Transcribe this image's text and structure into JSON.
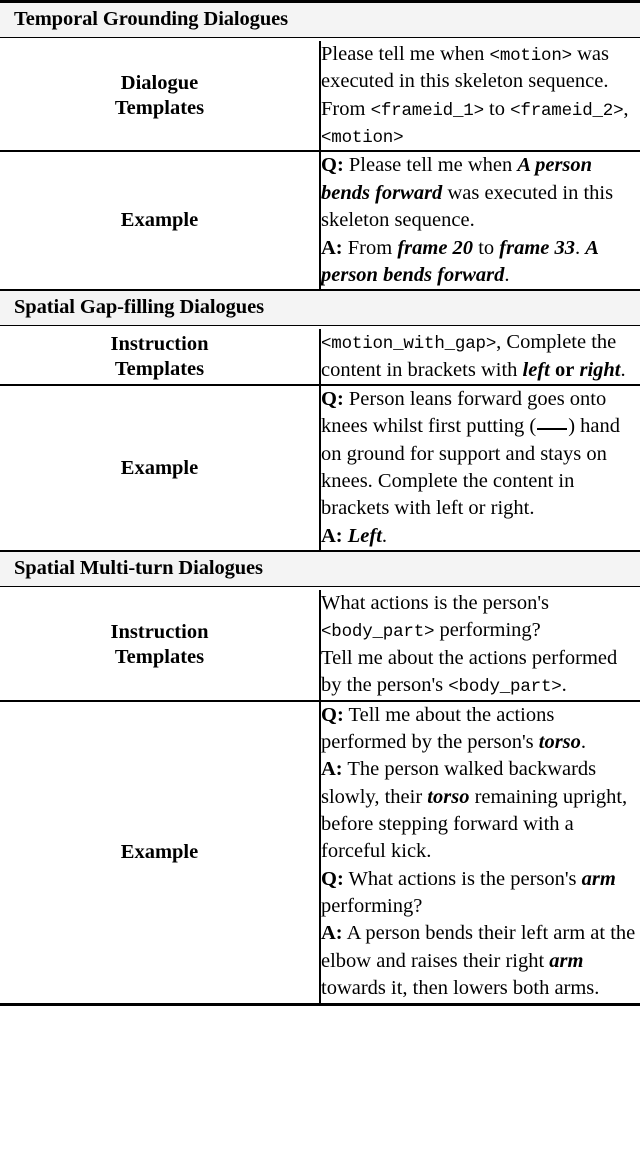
{
  "document": {
    "type": "table",
    "sections": [
      {
        "header": "Temporal Grounding Dialogues",
        "rows": [
          {
            "label_line1": "Dialogue",
            "label_line2": "Templates",
            "content_lines": [
              "Please tell me when <motion> was executed in this skeleton sequence.",
              "From <frameid_1> to <frameid_2>, <motion>"
            ],
            "tokens": [
              "<motion>",
              "<frameid_1>",
              "<frameid_2>"
            ]
          },
          {
            "label_line1": "Example",
            "label_line2": "",
            "content_lines": [
              "Q: Please tell me when A person bends forward was executed in this skeleton sequence.",
              "A: From frame 20 to frame 33. A person bends forward."
            ],
            "emphasis": [
              "A person bends forward",
              "frame 20",
              "frame 33",
              "A person bends forward"
            ]
          }
        ]
      },
      {
        "header": "Spatial Gap-filling Dialogues",
        "rows": [
          {
            "label_line1": "Instruction",
            "label_line2": "Templates",
            "content_lines": [
              "<motion_with_gap>, Complete the content in brackets with left or right."
            ],
            "tokens": [
              "<motion_with_gap>"
            ],
            "emphasis": [
              "left",
              "right"
            ]
          },
          {
            "label_line1": "Example",
            "label_line2": "",
            "content_lines": [
              "Q: Person leans forward goes onto knees whilst first putting (___) hand on ground for support and stays on knees. Complete the content in brackets with left or right.",
              "A: Left."
            ],
            "emphasis": [
              "Left"
            ]
          }
        ]
      },
      {
        "header": "Spatial Multi-turn Dialogues",
        "rows": [
          {
            "label_line1": "Instruction",
            "label_line2": "Templates",
            "content_lines": [
              "What actions is the person's <body_part> performing?",
              "Tell me about the actions performed by the person's <body_part>."
            ],
            "tokens": [
              "<body_part>"
            ]
          },
          {
            "label_line1": "Example",
            "label_line2": "",
            "content_lines": [
              "Q: Tell me about the actions performed by the person's torso.",
              "A: The person walked backwards slowly, their torso remaining upright, before stepping forward with a forceful kick.",
              "Q: What actions is the person's arm performing?",
              "A: A person bends their left arm at the elbow and raises their right arm towards it, then lowers both arms."
            ],
            "emphasis": [
              "torso",
              "torso",
              "arm",
              "arm"
            ]
          }
        ]
      }
    ],
    "segments": {
      "s1r1": [
        {
          "t": "Please tell me when ",
          "s": "n"
        },
        {
          "t": "<motion>",
          "s": "m"
        },
        {
          "t": " was executed in this skeleton sequence. From ",
          "s": "n"
        },
        {
          "t": "<frameid_1>",
          "s": "m"
        },
        {
          "t": " to ",
          "s": "n"
        },
        {
          "t": "<frameid_2>",
          "s": "m"
        },
        {
          "t": ", ",
          "s": "n"
        },
        {
          "t": "<motion>",
          "s": "m"
        }
      ],
      "s1r2a": [
        {
          "t": "Q:",
          "s": "b"
        },
        {
          "t": " Please tell me when ",
          "s": "n"
        },
        {
          "t": "A person bends forward",
          "s": "i"
        },
        {
          "t": " was executed in this skeleton sequence.",
          "s": "n"
        }
      ],
      "s1r2b": [
        {
          "t": "A:",
          "s": "b"
        },
        {
          "t": " From ",
          "s": "n"
        },
        {
          "t": "frame 20",
          "s": "i"
        },
        {
          "t": " to ",
          "s": "n"
        },
        {
          "t": "frame 33",
          "s": "i"
        },
        {
          "t": ". ",
          "s": "n"
        },
        {
          "t": "A person bends forward",
          "s": "i"
        },
        {
          "t": ".",
          "s": "n"
        }
      ],
      "s2r1": [
        {
          "t": "<motion_with_gap>",
          "s": "m"
        },
        {
          "t": ", Complete the content in brackets with ",
          "s": "n"
        },
        {
          "t": "left",
          "s": "i"
        },
        {
          "t": " ",
          "s": "n"
        },
        {
          "t": "or",
          "s": "b"
        },
        {
          "t": " ",
          "s": "n"
        },
        {
          "t": "right",
          "s": "i"
        },
        {
          "t": ".",
          "s": "n"
        }
      ],
      "s2r2a": [
        {
          "t": "Q:",
          "s": "b"
        },
        {
          "t": " Person leans forward goes onto knees whilst first putting (",
          "s": "n"
        },
        {
          "t": "",
          "s": "g"
        },
        {
          "t": ") hand on ground for support and stays on knees. Complete the content in brackets with left or right.",
          "s": "n"
        }
      ],
      "s2r2b": [
        {
          "t": "A:",
          "s": "b"
        },
        {
          "t": " ",
          "s": "n"
        },
        {
          "t": "Left",
          "s": "i"
        },
        {
          "t": ".",
          "s": "n"
        }
      ],
      "s3r1a": [
        {
          "t": "What actions is the person's ",
          "s": "n"
        },
        {
          "t": "<body_part>",
          "s": "m"
        },
        {
          "t": " performing?",
          "s": "n"
        }
      ],
      "s3r1b": [
        {
          "t": "Tell me about the actions performed by the person's ",
          "s": "n"
        },
        {
          "t": "<body_part>",
          "s": "m"
        },
        {
          "t": ".",
          "s": "n"
        }
      ],
      "s3r2a": [
        {
          "t": "Q:",
          "s": "b"
        },
        {
          "t": " Tell me about the actions performed by the person's ",
          "s": "n"
        },
        {
          "t": "torso",
          "s": "i"
        },
        {
          "t": ".",
          "s": "n"
        }
      ],
      "s3r2b": [
        {
          "t": "A:",
          "s": "b"
        },
        {
          "t": " The person walked backwards slowly, their ",
          "s": "n"
        },
        {
          "t": "torso",
          "s": "i"
        },
        {
          "t": " remaining upright, before stepping forward with a forceful kick.",
          "s": "n"
        }
      ],
      "s3r2c": [
        {
          "t": "Q:",
          "s": "b"
        },
        {
          "t": " What actions is the person's ",
          "s": "n"
        },
        {
          "t": "arm",
          "s": "i"
        },
        {
          "t": " performing?",
          "s": "n"
        }
      ],
      "s3r2d": [
        {
          "t": "A:",
          "s": "b"
        },
        {
          "t": " A person bends their left arm at the elbow and raises their right ",
          "s": "n"
        },
        {
          "t": "arm",
          "s": "i"
        },
        {
          "t": " towards it, then lowers both arms.",
          "s": "n"
        }
      ]
    }
  }
}
